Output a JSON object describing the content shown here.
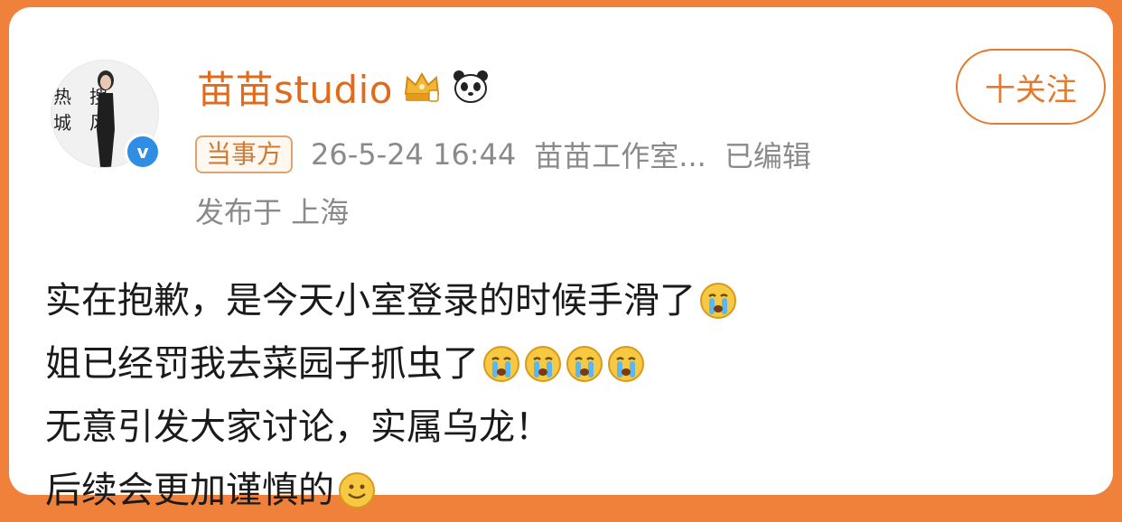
{
  "post": {
    "author": {
      "name": "苗苗studio",
      "avatar_text": "热搜城风",
      "verified_mark": "v",
      "badges": [
        "crown-badge-icon",
        "panda-icon"
      ]
    },
    "follow_label": "十关注",
    "tag": "当事方",
    "timestamp": "26-5-24 16:44",
    "source": "苗苗工作室...",
    "edited": "已编辑",
    "location": "发布于 上海",
    "lines": [
      {
        "text": "实在抱歉，是今天小室登录的时候手滑了",
        "emoji_count": 1
      },
      {
        "text": "姐已经罚我去菜园子抓虫了",
        "emoji_count": 4
      },
      {
        "text": "无意引发大家讨论，实属乌龙！",
        "emoji_count": 0
      },
      {
        "text": "后续会更加谨慎的",
        "emoji_count": 1
      }
    ]
  },
  "colors": {
    "background": "#f0813a",
    "name": "#e36a19",
    "follow": "#e37a2d",
    "meta": "#8a8a8a",
    "verify": "#2f8de4"
  }
}
